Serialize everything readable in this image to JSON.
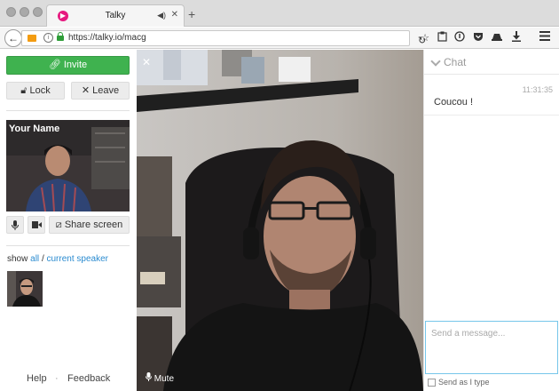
{
  "browser": {
    "tab_title": "Talky",
    "url": "https://talky.io/macg",
    "tab_close": "✕",
    "new_tab": "+"
  },
  "sidebar": {
    "invite_label": "Invite",
    "lock_label": "Lock",
    "leave_label": "Leave",
    "self_name": "Your Name",
    "share_label": "Share screen",
    "show_prefix": "show",
    "show_all": "all",
    "show_sep": "/",
    "show_current": "current speaker",
    "help_label": "Help",
    "footer_sep": "·",
    "feedback_label": "Feedback"
  },
  "main": {
    "close_glyph": "✕",
    "mute_label": "Mute"
  },
  "chat": {
    "title": "Chat",
    "time": "11:31:35",
    "message": "Coucou !",
    "placeholder": "Send a message...",
    "send_as_type_label": "Send as I type"
  },
  "icons": {
    "back": "back-arrow-icon",
    "camera": "camera-icon",
    "info": "info-icon",
    "lock": "lock-icon",
    "reload": "reload-icon",
    "star": "star-icon",
    "reading-list": "clipboard-icon",
    "pocket": "pocket-icon",
    "download": "download-icon",
    "menu": "hamburger-menu-icon"
  },
  "colors": {
    "invite_green": "#3fb24f",
    "link_blue": "#2a8bd0",
    "input_focus": "#77c6ea"
  }
}
